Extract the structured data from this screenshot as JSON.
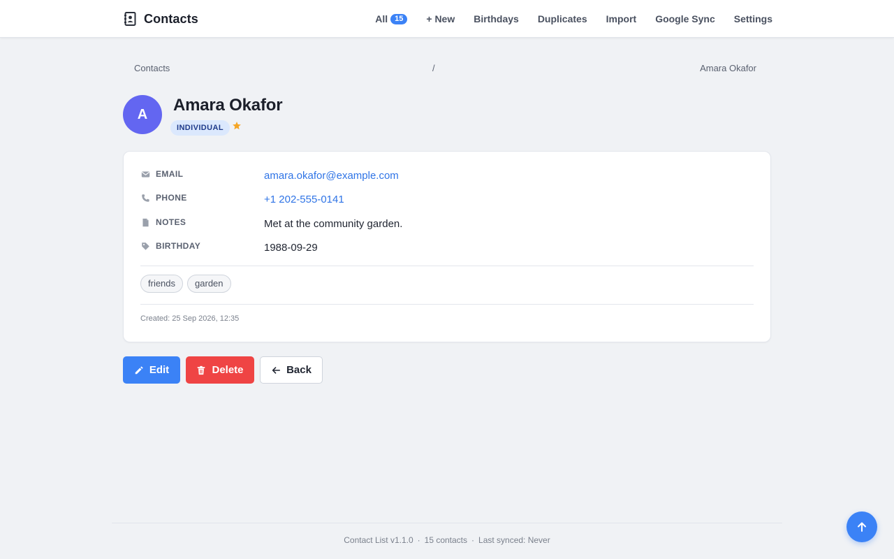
{
  "app": {
    "title": "Contacts",
    "brand_icon": "address-book-icon"
  },
  "nav": {
    "items": [
      {
        "label": "All",
        "badge": "15"
      },
      {
        "label": "+ New"
      },
      {
        "label": "Birthdays"
      },
      {
        "label": "Duplicates"
      },
      {
        "label": "Import"
      },
      {
        "label": "Google Sync"
      },
      {
        "label": "Settings"
      }
    ]
  },
  "breadcrumb": {
    "home": "Contacts",
    "separator": "/",
    "current": "Amara Okafor"
  },
  "contact": {
    "initial": "A",
    "name": "Amara Okafor",
    "type": "INDIVIDUAL",
    "favorite": true,
    "avatar_color": "#6366f1",
    "fields": [
      {
        "label": "EMAIL",
        "icon": "envelope-icon",
        "value": "amara.okafor@example.com",
        "link": true
      },
      {
        "label": "PHONE",
        "icon": "phone-icon",
        "value": "+1 202-555-0141",
        "link": true
      },
      {
        "label": "NOTES",
        "icon": "document-icon",
        "value": "Met at the community garden.",
        "link": false
      },
      {
        "label": "BIRTHDAY",
        "icon": "tag-icon",
        "value": "1988-09-29",
        "link": false
      }
    ],
    "tags": [
      "friends",
      "garden"
    ],
    "created": "Created: 25 Sep 2026, 12:35"
  },
  "actions": {
    "edit": "Edit",
    "delete": "Delete",
    "back": "Back"
  },
  "footer": {
    "version": "Contact List v1.1.0",
    "separator": "·",
    "count": "15 contacts",
    "synced": "Last synced: Never"
  },
  "colors": {
    "accent": "#3b82f6",
    "danger": "#ef4444",
    "star": "#f5a524"
  }
}
